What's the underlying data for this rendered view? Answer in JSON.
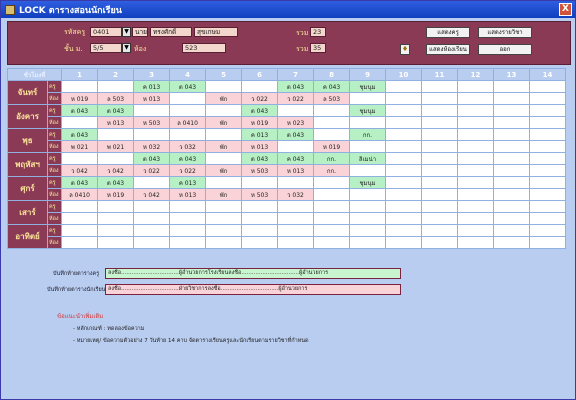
{
  "window": {
    "title": "LOCK ตารางสอนนักเรียน",
    "close_label": "X"
  },
  "header": {
    "teacher_code_label": "รหัสครู",
    "teacher_code_value": "0401",
    "name_label": "นาย",
    "first_name_value": "ทรงศักดิ์",
    "last_name_value": "สุขเกษม",
    "level_label": "ชั้น ม.",
    "level_value": "5/5",
    "class_label": "ห้อง",
    "class_value": "523",
    "total1_label": "รวม",
    "total1_value": "23",
    "total2_label": "รวม",
    "total2_value": "35",
    "buttons": {
      "show_teacher": "แสดงครู",
      "show_report": "แสดงรายวิชา",
      "show_room": "แสดงห้องเรียน",
      "exit": "ออก"
    },
    "key_icon": "key-icon"
  },
  "table": {
    "corner_label": "ชั่วโมงที่",
    "periods": [
      "1",
      "2",
      "3",
      "4",
      "5",
      "6",
      "7",
      "8",
      "9",
      "10",
      "11",
      "12",
      "13",
      "14"
    ],
    "row_labels": {
      "teacher": "ครู",
      "room": "ห้อง"
    },
    "days": [
      {
        "name": "จันทร์",
        "teacher": [
          "",
          "",
          "ค 013",
          "ต 043",
          "",
          "",
          "ต 043",
          "ค 043",
          "ชุมนุม",
          "",
          "",
          "",
          "",
          ""
        ],
        "room": [
          "ห 019",
          "ล 503",
          "ห 013",
          "",
          "พัก",
          "ว 022",
          "ว 022",
          "ล 503",
          "",
          "",
          "",
          "",
          "",
          ""
        ]
      },
      {
        "name": "อังคาร",
        "teacher": [
          "ต 043",
          "ต 043",
          "",
          "",
          "",
          "ต 043",
          "",
          "",
          "ชุมนุม",
          "",
          "",
          "",
          "",
          ""
        ],
        "room": [
          "",
          "ห 013",
          "ห 503",
          "ล 0410",
          "พัก",
          "ห 019",
          "ห 023",
          "",
          "",
          "",
          "",
          "",
          "",
          ""
        ]
      },
      {
        "name": "พุธ",
        "teacher": [
          "ต 043",
          "",
          "",
          "",
          "",
          "ค 013",
          "ต 043",
          "",
          "กก.",
          "",
          "",
          "",
          "",
          ""
        ],
        "room": [
          "พ 021",
          "พ 021",
          "ห 032",
          "ว 032",
          "พัก",
          "ห 013",
          "",
          "ห 019",
          "",
          "",
          "",
          "",
          "",
          ""
        ]
      },
      {
        "name": "พฤหัสฯ",
        "teacher": [
          "",
          "",
          "ต 043",
          "ค 043",
          "",
          "ต 043",
          "ค 043",
          "กก.",
          "ลิเมน่า",
          "",
          "",
          "",
          "",
          ""
        ],
        "room": [
          "ว 042",
          "ว 042",
          "ว 022",
          "ว 022",
          "พัก",
          "ห 503",
          "ห 013",
          "กก.",
          "",
          "",
          "",
          "",
          "",
          ""
        ]
      },
      {
        "name": "ศุกร์",
        "teacher": [
          "ต 043",
          "ต 043",
          "",
          "ค 013",
          "",
          "",
          "",
          "",
          "ชุมนุม",
          "",
          "",
          "",
          "",
          ""
        ],
        "room": [
          "ล 0410",
          "ห 019",
          "ว 042",
          "ห 013",
          "พัก",
          "ห 503",
          "ว 032",
          "",
          "",
          "",
          "",
          "",
          "",
          ""
        ]
      },
      {
        "name": "เสาร์",
        "teacher": [
          "",
          "",
          "",
          "",
          "",
          "",
          "",
          "",
          "",
          "",
          "",
          "",
          "",
          ""
        ],
        "room": [
          "",
          "",
          "",
          "",
          "",
          "",
          "",
          "",
          "",
          "",
          "",
          "",
          "",
          ""
        ]
      },
      {
        "name": "อาทิตย์",
        "teacher": [
          "",
          "",
          "",
          "",
          "",
          "",
          "",
          "",
          "",
          "",
          "",
          "",
          "",
          ""
        ],
        "room": [
          "",
          "",
          "",
          "",
          "",
          "",
          "",
          "",
          "",
          "",
          "",
          "",
          "",
          ""
        ]
      }
    ]
  },
  "notes": {
    "teacher_note_label": "บันทึกท้ายตารางครู",
    "teacher_note_value": "ลงชื่อ.................................ผู้อำนวยการโรงเรียนลงชื่อ.................................ผู้อำนวยการ",
    "student_note_label": "บันทึกท้ายตารางนักเรียน",
    "student_note_value": "ลงชื่อ.................................ฝ่ายวิชาการลงชื่อ.................................ผู้อำนวยการ",
    "title": "ข้อแนะนำเพิ่มเติม",
    "line1": "- หลักเกณฑ์ : ทดลองข้อความ",
    "line2": "- หมายเหตุ/ ข้อความตัวอย่าง 7 วันท้าย 14 คาบ  จัดตารางเรียนครูและนักเรียนตามรายวิชาที่กำหนด"
  }
}
